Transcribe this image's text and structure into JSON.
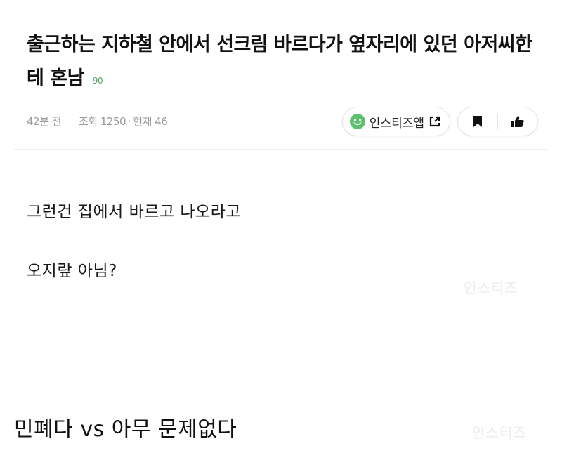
{
  "post": {
    "title": "출근하는 지하철 안에서 선크림 바르다가 옆자리에 있던 아저씨한테 혼남",
    "comment_count": "90",
    "meta": {
      "time": "42분 전",
      "views": "조회 1250",
      "current": "현재 46"
    },
    "actions": {
      "app_button_label": "인스티즈앱"
    },
    "body": [
      "그런건 집에서 바르고 나오라고",
      "오지랖 아님?"
    ],
    "watermark": "인스티즈"
  },
  "caption": "민폐다 vs 아무 문제없다"
}
